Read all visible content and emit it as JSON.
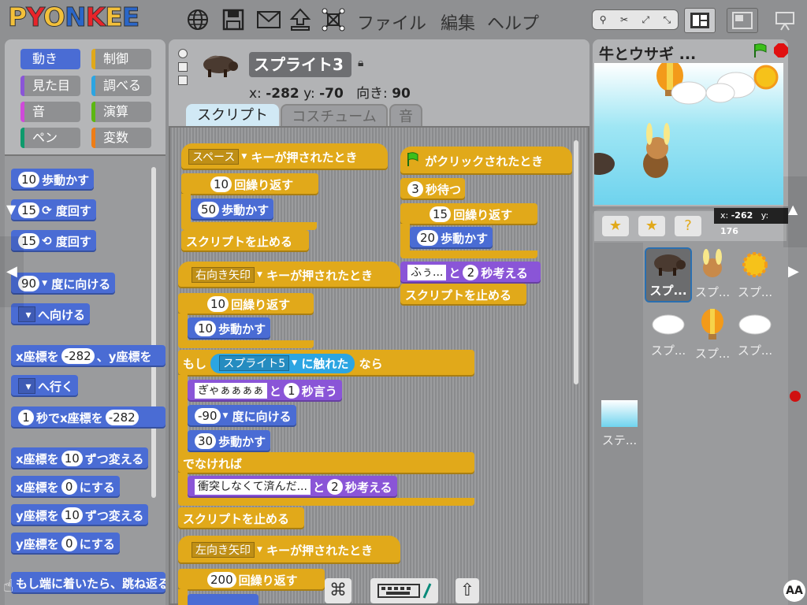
{
  "app": {
    "logo": "PYONKEE"
  },
  "menu": {
    "file": "ファイル",
    "edit": "編集",
    "help": "ヘルプ"
  },
  "categories": [
    {
      "label": "動き",
      "color": "#4a6cd4"
    },
    {
      "label": "制御",
      "color": "#e1a91a"
    },
    {
      "label": "見た目",
      "color": "#8a55d7"
    },
    {
      "label": "調べる",
      "color": "#2ca5e2"
    },
    {
      "label": "音",
      "color": "#cf4ad9"
    },
    {
      "label": "演算",
      "color": "#5cb712"
    },
    {
      "label": "ペン",
      "color": "#0e9a6c"
    },
    {
      "label": "変数",
      "color": "#ee7d16"
    }
  ],
  "palette": {
    "move": {
      "num": "10",
      "text": "歩動かす"
    },
    "turn_right": {
      "num": "15",
      "text": "度回す"
    },
    "turn_left": {
      "num": "15",
      "text": "度回す"
    },
    "point_dir": {
      "num": "90",
      "text": "度に向ける"
    },
    "point_towards": {
      "text": "へ向ける"
    },
    "goto_xy": {
      "t1": "x座標を",
      "x": "-282",
      "t2": "、y座標を"
    },
    "goto": {
      "text": "へ行く"
    },
    "glide": {
      "num": "1",
      "t1": "秒でx座標を",
      "x": "-282"
    },
    "change_x": {
      "t1": "x座標を",
      "num": "10",
      "t2": "ずつ変える"
    },
    "set_x": {
      "t1": "x座標を",
      "num": "0",
      "t2": "にする"
    },
    "change_y": {
      "t1": "y座標を",
      "num": "10",
      "t2": "ずつ変える"
    },
    "set_y": {
      "t1": "y座標を",
      "num": "0",
      "t2": "にする"
    },
    "bounce": {
      "text": "もし端に着いたら、跳ね返る"
    }
  },
  "sprite": {
    "name": "スプライト3",
    "x_label": "x:",
    "x": "-282",
    "y_label": "y:",
    "y": "-70",
    "dir_label": "向き:",
    "dir": "90"
  },
  "tabs": {
    "scripts": "スクリプト",
    "costumes": "コスチューム",
    "sounds": "音"
  },
  "scripts": {
    "s1": {
      "key": "スペース",
      "hat": "キーが押されたとき",
      "repeat_num": "10",
      "repeat": "回繰り返す",
      "move_num": "50",
      "move": "歩動かす",
      "stop": "スクリプトを止める"
    },
    "s2": {
      "key": "右向き矢印",
      "hat": "キーが押されたとき",
      "repeat_num": "10",
      "repeat": "回繰り返す",
      "move_num": "10",
      "move": "歩動かす",
      "if": "もし",
      "sprite": "スプライト5",
      "touching": "に触れた",
      "then": "なら",
      "say": "ぎゃぁぁぁぁ",
      "and": "と",
      "say_num": "1",
      "say_t": "秒言う",
      "dir": "-90",
      "dir_t": "度に向ける",
      "move2_num": "30",
      "move2": "歩動かす",
      "else": "でなければ",
      "think": "衝突しなくて済んだ...",
      "and2": "と",
      "think_num": "2",
      "think_t": "秒考える",
      "stop": "スクリプトを止める"
    },
    "s3": {
      "key": "左向き矢印",
      "hat": "キーが押されたとき",
      "repeat_num": "200",
      "repeat": "回繰り返す"
    },
    "s4": {
      "hat": "がクリックされたとき",
      "wait_num": "3",
      "wait": "秒待つ",
      "repeat_num": "15",
      "repeat": "回繰り返す",
      "move_num": "20",
      "move": "歩動かす",
      "think": "ふぅ...",
      "and": "と",
      "think_num": "2",
      "think_t": "秒考える",
      "stop": "スクリプトを止める"
    }
  },
  "stage": {
    "title": "牛とウサギ ...",
    "mouse_x_label": "x:",
    "mouse_x": "-262",
    "mouse_y_label": "y:",
    "mouse_y": "176"
  },
  "sprites": [
    {
      "label": "スプ..."
    },
    {
      "label": "スプ..."
    },
    {
      "label": "スプ..."
    },
    {
      "label": "スプ..."
    },
    {
      "label": "スプ..."
    },
    {
      "label": "スプ..."
    }
  ],
  "stage_thumb": {
    "label": "ステ..."
  }
}
